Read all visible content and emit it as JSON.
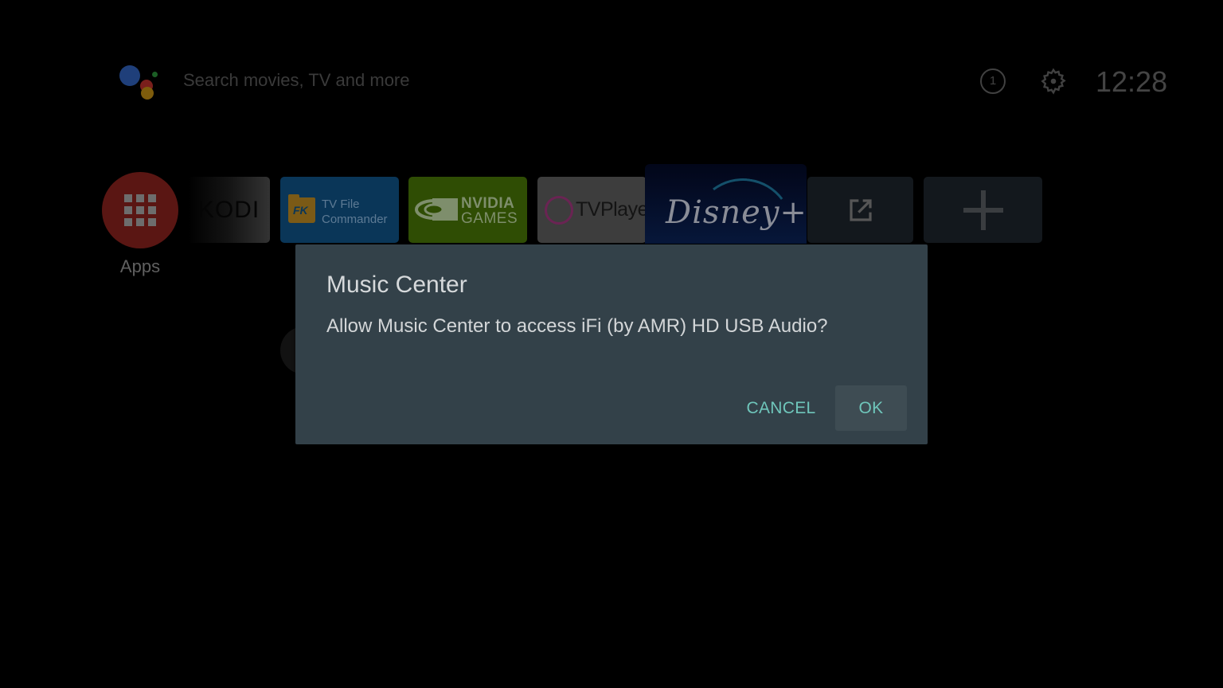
{
  "top_bar": {
    "search_placeholder": "Search movies, TV and more",
    "notification_count": "1",
    "clock": "12:28",
    "icons": [
      "google-assistant-icon",
      "notification-icon",
      "settings-gear-icon"
    ]
  },
  "apps_row": {
    "apps_button_label": "Apps",
    "tiles": [
      {
        "name": "Kodi",
        "text": "KODI"
      },
      {
        "name": "TV File Commander",
        "badge": "FK",
        "line1": "TV File",
        "line2": "Commander"
      },
      {
        "name": "NVIDIA Games",
        "line1": "NVIDIA",
        "line2": "GAMES"
      },
      {
        "name": "TVPlayer",
        "text": "TVPlaye"
      },
      {
        "name": "Disney+",
        "text": "Disney+"
      },
      {
        "name": "Open external",
        "icon": "open-external-icon"
      },
      {
        "name": "Add app",
        "icon": "plus-icon"
      }
    ]
  },
  "dialog": {
    "title": "Music Center",
    "message": "Allow Music Center to access iFi (by AMR) HD USB Audio?",
    "cancel_label": "CANCEL",
    "ok_label": "OK",
    "accent_color": "#6fc6bb",
    "background_color": "#334149"
  }
}
